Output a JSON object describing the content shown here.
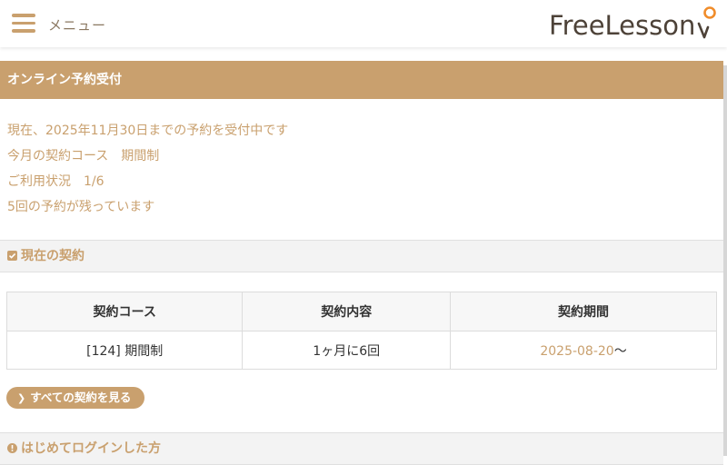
{
  "header": {
    "menu_label": "メニュー",
    "logo_text": "FreeLesson"
  },
  "banner": {
    "title": "オンライン予約受付"
  },
  "info": {
    "lines": [
      "現在、2025年11月30日までの予約を受付中です",
      "今月の契約コース　期間制",
      "ご利用状況　1/6",
      "5回の予約が残っています"
    ]
  },
  "current_contract": {
    "heading": "現在の契約",
    "columns": [
      "契約コース",
      "契約内容",
      "契約期間"
    ],
    "rows": [
      {
        "course": "[124] 期間制",
        "content": "1ヶ月に6回",
        "period_start": "2025-08-20",
        "period_suffix": "〜"
      }
    ],
    "all_button_label": "すべての契約を見る"
  },
  "first_login": {
    "heading": "はじめてログインした方"
  },
  "colors": {
    "accent": "#c9a06e",
    "logo_dark": "#4d4238",
    "logo_orange": "#f08c2a"
  }
}
